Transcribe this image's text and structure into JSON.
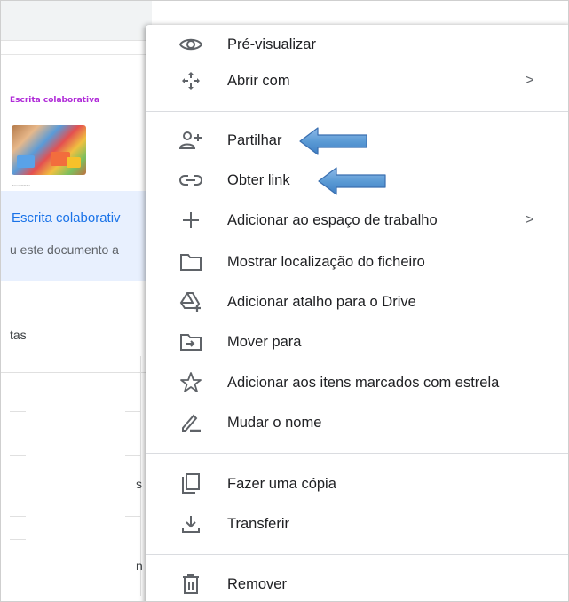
{
  "background": {
    "doc_title": "Escrita colaborativa",
    "thumbnail_caption": "Potencialidades",
    "info_title": "Escrita colaborativ",
    "info_subtitle": "u este documento a",
    "section_label": "tas",
    "partial_letter_1": "s",
    "partial_letter_2": "n"
  },
  "menu": {
    "items": [
      {
        "label": "Pré-visualizar",
        "icon": "eye-icon"
      },
      {
        "label": "Abrir com",
        "icon": "move-arrows-icon",
        "submenu": true
      },
      {
        "label": "Partilhar",
        "icon": "person-add-icon"
      },
      {
        "label": "Obter link",
        "icon": "link-icon"
      },
      {
        "label": "Adicionar ao espaço de trabalho",
        "icon": "plus-icon",
        "submenu": true
      },
      {
        "label": "Mostrar localização do ficheiro",
        "icon": "folder-icon"
      },
      {
        "label": "Adicionar atalho para o Drive",
        "icon": "drive-shortcut-icon"
      },
      {
        "label": "Mover para",
        "icon": "move-to-folder-icon"
      },
      {
        "label": "Adicionar aos itens marcados com estrela",
        "icon": "star-icon"
      },
      {
        "label": "Mudar o nome",
        "icon": "pencil-icon"
      },
      {
        "label": "Fazer uma cópia",
        "icon": "copy-icon"
      },
      {
        "label": "Transferir",
        "icon": "download-icon"
      },
      {
        "label": "Remover",
        "icon": "trash-icon"
      }
    ],
    "submenu_chevron": ">"
  },
  "colors": {
    "doc_title": "#b02bd8",
    "info_title": "#1a73e8",
    "info_background": "#e8f0fe",
    "callout_arrow": "#5b9bd5"
  },
  "annotations": [
    {
      "type": "callout-arrow",
      "points_to": "Partilhar"
    },
    {
      "type": "callout-arrow",
      "points_to": "Obter link"
    }
  ]
}
